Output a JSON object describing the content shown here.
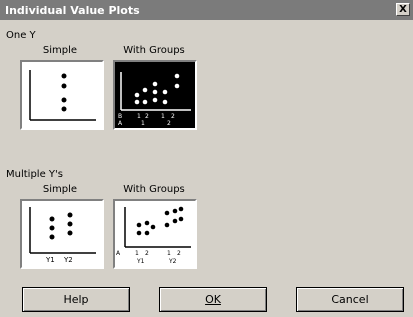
{
  "window": {
    "title": "Individual Value Plots",
    "close_label": "X"
  },
  "groups": [
    {
      "label": "One Y",
      "options": [
        {
          "label": "Simple"
        },
        {
          "label": "With Groups"
        }
      ]
    },
    {
      "label": "Multiple Y's",
      "options": [
        {
          "label": "Simple"
        },
        {
          "label": "With Groups"
        }
      ]
    }
  ],
  "thumb_text": {
    "oney_groups_a": "A",
    "oney_groups_b": "B",
    "oney_groups_1": "1",
    "oney_groups_2": "2",
    "oney_groups_1b": "1",
    "oney_groups_2b": "2",
    "oney_groups_1c": "1",
    "oney_groups_2c": "2",
    "multi_simple_y1": "Y1",
    "multi_simple_y2": "Y2",
    "multi_groups_a": "A",
    "multi_groups_1": "1",
    "multi_groups_2": "2",
    "multi_groups_y1": "Y1",
    "multi_groups_1b": "1",
    "multi_groups_2b": "2",
    "multi_groups_y2": "Y2"
  },
  "buttons": {
    "help": "Help",
    "ok": "OK",
    "cancel": "Cancel"
  }
}
